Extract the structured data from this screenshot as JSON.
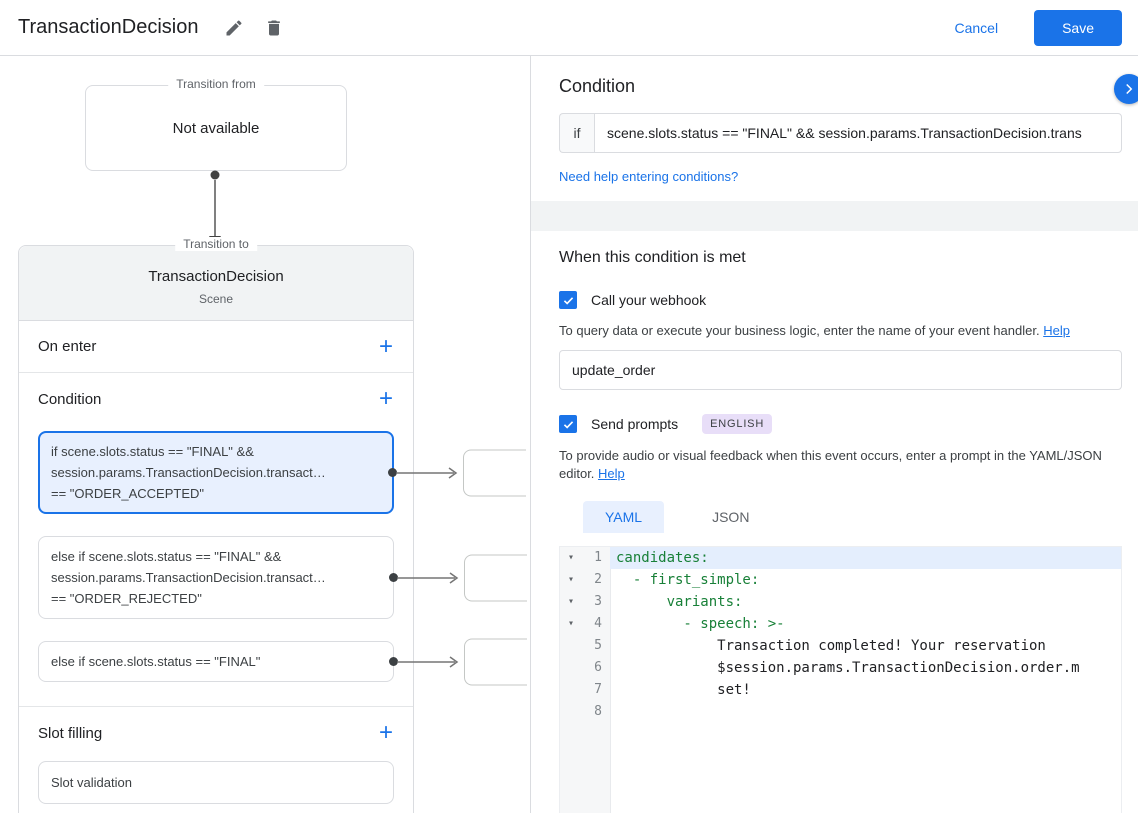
{
  "header": {
    "title": "TransactionDecision",
    "cancel_label": "Cancel",
    "save_label": "Save"
  },
  "diagram": {
    "transition_from": {
      "label": "Transition from",
      "content": "Not available"
    },
    "transition_to": {
      "label": "Transition to",
      "scene_name": "TransactionDecision",
      "scene_type": "Scene"
    },
    "sections": {
      "on_enter": {
        "title": "On enter"
      },
      "condition": {
        "title": "Condition",
        "cards": [
          {
            "text": "if scene.slots.status == \"FINAL\" &&\nsession.params.TransactionDecision.transact…\n== \"ORDER_ACCEPTED\"",
            "selected": true
          },
          {
            "text": "else if scene.slots.status == \"FINAL\" &&\nsession.params.TransactionDecision.transact…\n== \"ORDER_REJECTED\"",
            "selected": false
          },
          {
            "text": "else if scene.slots.status == \"FINAL\"",
            "selected": false
          }
        ]
      },
      "slot_filling": {
        "title": "Slot filling",
        "cards": [
          {
            "text": "Slot validation"
          }
        ]
      }
    }
  },
  "condition_panel": {
    "title": "Condition",
    "if_label": "if",
    "expression": "scene.slots.status == \"FINAL\" && session.params.TransactionDecision.trans",
    "conditions_help_link": "Need help entering conditions?",
    "when_met_title": "When this condition is met",
    "webhook": {
      "label": "Call your webhook",
      "checked": true,
      "description": "To query data or execute your business logic, enter the name of your event handler.",
      "help_label": "Help",
      "handler_value": "update_order"
    },
    "prompts": {
      "label": "Send prompts",
      "checked": true,
      "language_badge": "ENGLISH",
      "description": "To provide audio or visual feedback when this event occurs, enter a prompt in the YAML/JSON editor.",
      "help_label": "Help"
    },
    "editor": {
      "tabs": [
        {
          "label": "YAML",
          "active": true
        },
        {
          "label": "JSON",
          "active": false
        }
      ],
      "lines": [
        {
          "num": "1",
          "text": "candidates:",
          "type": "key",
          "fold": true,
          "selected": true
        },
        {
          "num": "2",
          "text": "  - first_simple:",
          "type": "key",
          "fold": true,
          "selected": false
        },
        {
          "num": "3",
          "text": "      variants:",
          "type": "key",
          "fold": true,
          "selected": false
        },
        {
          "num": "4",
          "text": "        - speech: >-",
          "type": "key",
          "fold": true,
          "selected": false
        },
        {
          "num": "5",
          "text": "            Transaction completed! Your reservation",
          "type": "plain",
          "fold": false,
          "selected": false
        },
        {
          "num": "6",
          "text": "            $session.params.TransactionDecision.order.m",
          "type": "plain",
          "fold": false,
          "selected": false
        },
        {
          "num": "7",
          "text": "            set!",
          "type": "plain",
          "fold": false,
          "selected": false
        },
        {
          "num": "8",
          "text": "",
          "type": "plain",
          "fold": false,
          "selected": false
        }
      ]
    }
  },
  "colors": {
    "accent": "#1a73e8",
    "selected_card_bg": "#e8f0fe",
    "code_key_green": "#188038",
    "code_selection": "#e4eefd",
    "language_badge_bg": "#e8def8",
    "divider_band": "#f1f3f4"
  }
}
